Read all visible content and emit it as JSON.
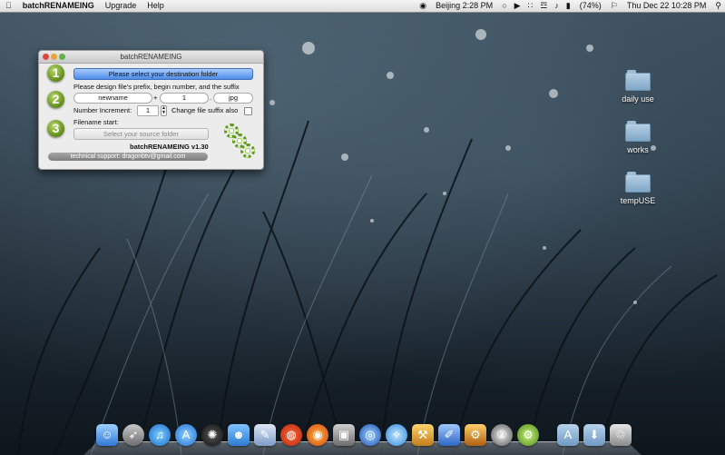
{
  "menubar": {
    "apple_icon": "apple-icon",
    "app_name": "batchRENAMEING",
    "menu_upgrade": "Upgrade",
    "menu_help": "Help",
    "clock_city": "Beijing 2:28 PM",
    "battery": "(74%)",
    "datetime": "Thu Dec 22  10:28 PM"
  },
  "window": {
    "title": "batchRENAMEING",
    "step1_number": "1",
    "step2_number": "2",
    "step3_number": "3",
    "destination_button": "Please select your destination folder",
    "design_label": "Please design file's prefix, begin number, and the suffix",
    "prefix_value": "newname",
    "plus_sign": "+",
    "begin_value": "1",
    "dot_sign": ".",
    "suffix_value": "jpg",
    "increment_label": "Number Increment:",
    "increment_value": "1",
    "change_suffix_label": "Change file suffix also",
    "filename_start_label": "Filename start:",
    "source_button": "Select your source folder",
    "version_label": "batchRENAMEING  v1.30",
    "support_label": "technical support: dragonbtv@gmail.com"
  },
  "desktop": {
    "folders": [
      "daily use",
      "works",
      "tempUSE"
    ]
  },
  "dock": {
    "items": [
      "finder-icon",
      "rocket-icon",
      "itunes-icon",
      "app-store-icon",
      "dashboard-icon",
      "ichat-icon",
      "preview-icon",
      "fruit-icon",
      "firefox-icon",
      "photo-icon",
      "globe-icon",
      "safari-icon",
      "xcode-icon",
      "pencil-icon",
      "zip-icon",
      "batchrenameing-icon",
      "applications-folder-icon",
      "downloads-folder-icon",
      "trash-icon"
    ]
  }
}
